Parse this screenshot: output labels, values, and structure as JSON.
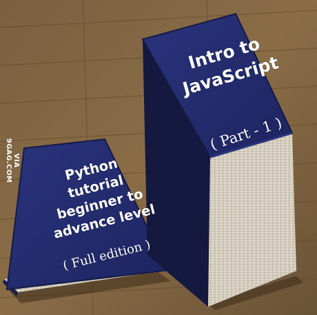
{
  "watermark": "VIA 9GAG.COM",
  "small_book": {
    "title_lines": [
      "Python",
      "tutorial",
      "beginner to",
      "advance level"
    ],
    "subtitle": "( Full edition )",
    "cover_color": "#222a6e"
  },
  "big_book": {
    "title_lines": [
      "Intro to",
      "JavaScript"
    ],
    "subtitle": "( Part - 1 )",
    "cover_color": "#222a6e"
  },
  "colors": {
    "wood_light": "#8a6d45",
    "wood_dark": "#5a4228",
    "pages": "#d8d2c4"
  }
}
